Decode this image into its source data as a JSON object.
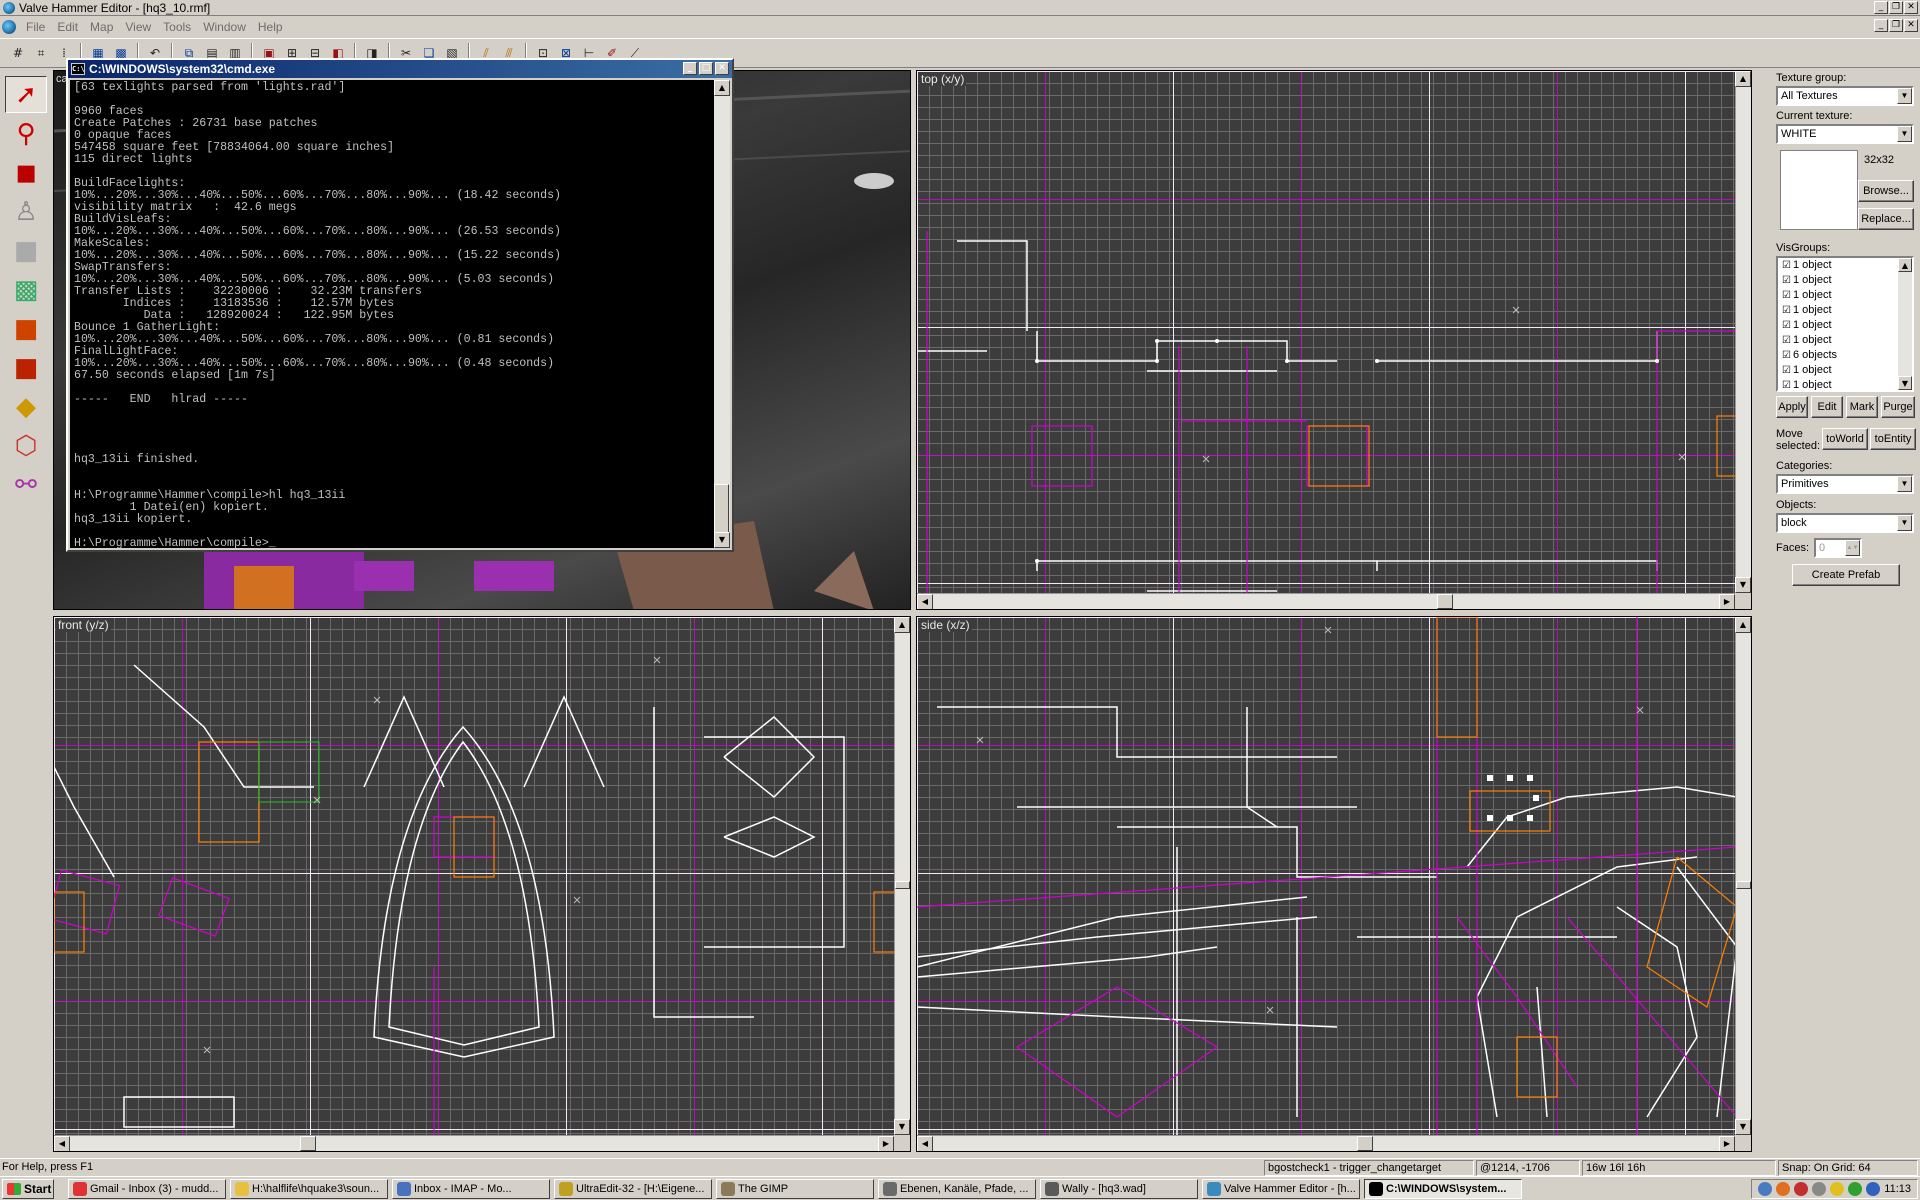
{
  "window": {
    "title": "Valve Hammer Editor - [hq3_10.rmf]"
  },
  "menu": [
    "File",
    "Edit",
    "Map",
    "View",
    "Tools",
    "Window",
    "Help"
  ],
  "toolbar": {
    "buttons": [
      "grid-icon",
      "3d-grid-icon",
      "dot-grid-icon",
      "grid-smaller-icon",
      "grid-larger-icon",
      "undo-icon",
      "copy-icon",
      "paste-icon",
      "carve-icon",
      "hollow-icon",
      "group-icon",
      "ungroup-icon",
      "hide-icon",
      "show-icon",
      "cut-icon",
      "paste-special-icon",
      "texture-lock-icon",
      "cordon-icon",
      "run-map-icon",
      "entity-report-icon",
      "problems-icon",
      "decals-icon",
      "paint-icon"
    ]
  },
  "tools": [
    "selection-tool-icon",
    "magnify-tool-icon",
    "camera-tool-icon",
    "entity-tool-icon",
    "block-tool-icon",
    "texture-tool-icon",
    "apply-texture-icon",
    "decal-tool-icon",
    "clip-tool-icon",
    "vertex-tool-icon",
    "path-tool-icon"
  ],
  "camera": {
    "label": "camera"
  },
  "cmd": {
    "title": "C:\\WINDOWS\\system32\\cmd.exe",
    "lines": [
      "[63 texlights parsed from 'lights.rad']",
      "",
      "9960 faces",
      "Create Patches : 26731 base patches",
      "0 opaque faces",
      "547458 square feet [78834064.00 square inches]",
      "115 direct lights",
      "",
      "BuildFacelights:",
      "10%...20%...30%...40%...50%...60%...70%...80%...90%... (18.42 seconds)",
      "visibility matrix   :  42.6 megs",
      "BuildVisLeafs:",
      "10%...20%...30%...40%...50%...60%...70%...80%...90%... (26.53 seconds)",
      "MakeScales:",
      "10%...20%...30%...40%...50%...60%...70%...80%...90%... (15.22 seconds)",
      "SwapTransfers:",
      "10%...20%...30%...40%...50%...60%...70%...80%...90%... (5.03 seconds)",
      "Transfer Lists :    32230006 :    32.23M transfers",
      "       Indices :    13183536 :    12.57M bytes",
      "          Data :   128920024 :   122.95M bytes",
      "Bounce 1 GatherLight:",
      "10%...20%...30%...40%...50%...60%...70%...80%...90%... (0.81 seconds)",
      "FinalLightFace:",
      "10%...20%...30%...40%...50%...60%...70%...80%...90%... (0.48 seconds)",
      "67.50 seconds elapsed [1m 7s]",
      "",
      "-----   END   hlrad -----",
      "",
      "",
      "",
      "",
      "hq3_13ii finished.",
      "",
      "",
      "H:\\Programme\\Hammer\\compile>hl hq3_13ii",
      "        1 Datei(en) kopiert.",
      "hq3_13ii kopiert.",
      "",
      "H:\\Programme\\Hammer\\compile>_"
    ]
  },
  "viewports": {
    "top": "top (x/y)",
    "front": "front (y/z)",
    "side": "side (x/z)"
  },
  "panel": {
    "texture_group_label": "Texture group:",
    "texture_group_value": "All Textures",
    "current_texture_label": "Current texture:",
    "current_texture_value": "WHITE",
    "texture_size": "32x32",
    "browse": "Browse...",
    "replace": "Replace...",
    "visgroups_label": "VisGroups:",
    "visgroups": [
      "1 object",
      "1 object",
      "1 object",
      "1 object",
      "1 object",
      "1 object",
      "6 objects",
      "1 object",
      "1 object"
    ],
    "apply": "Apply",
    "edit": "Edit",
    "mark": "Mark",
    "purge": "Purge",
    "move_selected": "Move selected:",
    "to_world": "toWorld",
    "to_entity": "toEntity",
    "categories_label": "Categories:",
    "categories_value": "Primitives",
    "objects_label": "Objects:",
    "objects_value": "block",
    "faces_label": "Faces:",
    "faces_value": "0",
    "create_prefab": "Create Prefab"
  },
  "status": {
    "help": "For Help, press F1",
    "selection": "bgostcheck1 - trigger_changetarget",
    "coords": "@1214, -1706",
    "size": "16w 16l 16h",
    "snap": "Snap: On Grid: 64"
  },
  "taskbar": {
    "start": "Start",
    "tasks": [
      "Gmail - Inbox (3) - mudd...",
      "H:\\halflife\\hquake3\\soun...",
      "Inbox -            IMAP - Mo...",
      "UltraEdit-32 - [H:\\Eigene...",
      "The GIMP",
      "Ebenen, Kanäle, Pfade, ...",
      "Wally - [hq3.wad]",
      "Valve Hammer Editor - [h...",
      "C:\\WINDOWS\\system..."
    ],
    "clock": "11:13"
  },
  "colors": {
    "grid_major": "#ffffff",
    "brush": "#d000d0",
    "entity": "#ff8000",
    "selected": "#ffffff",
    "title_active": "#0a246a"
  }
}
